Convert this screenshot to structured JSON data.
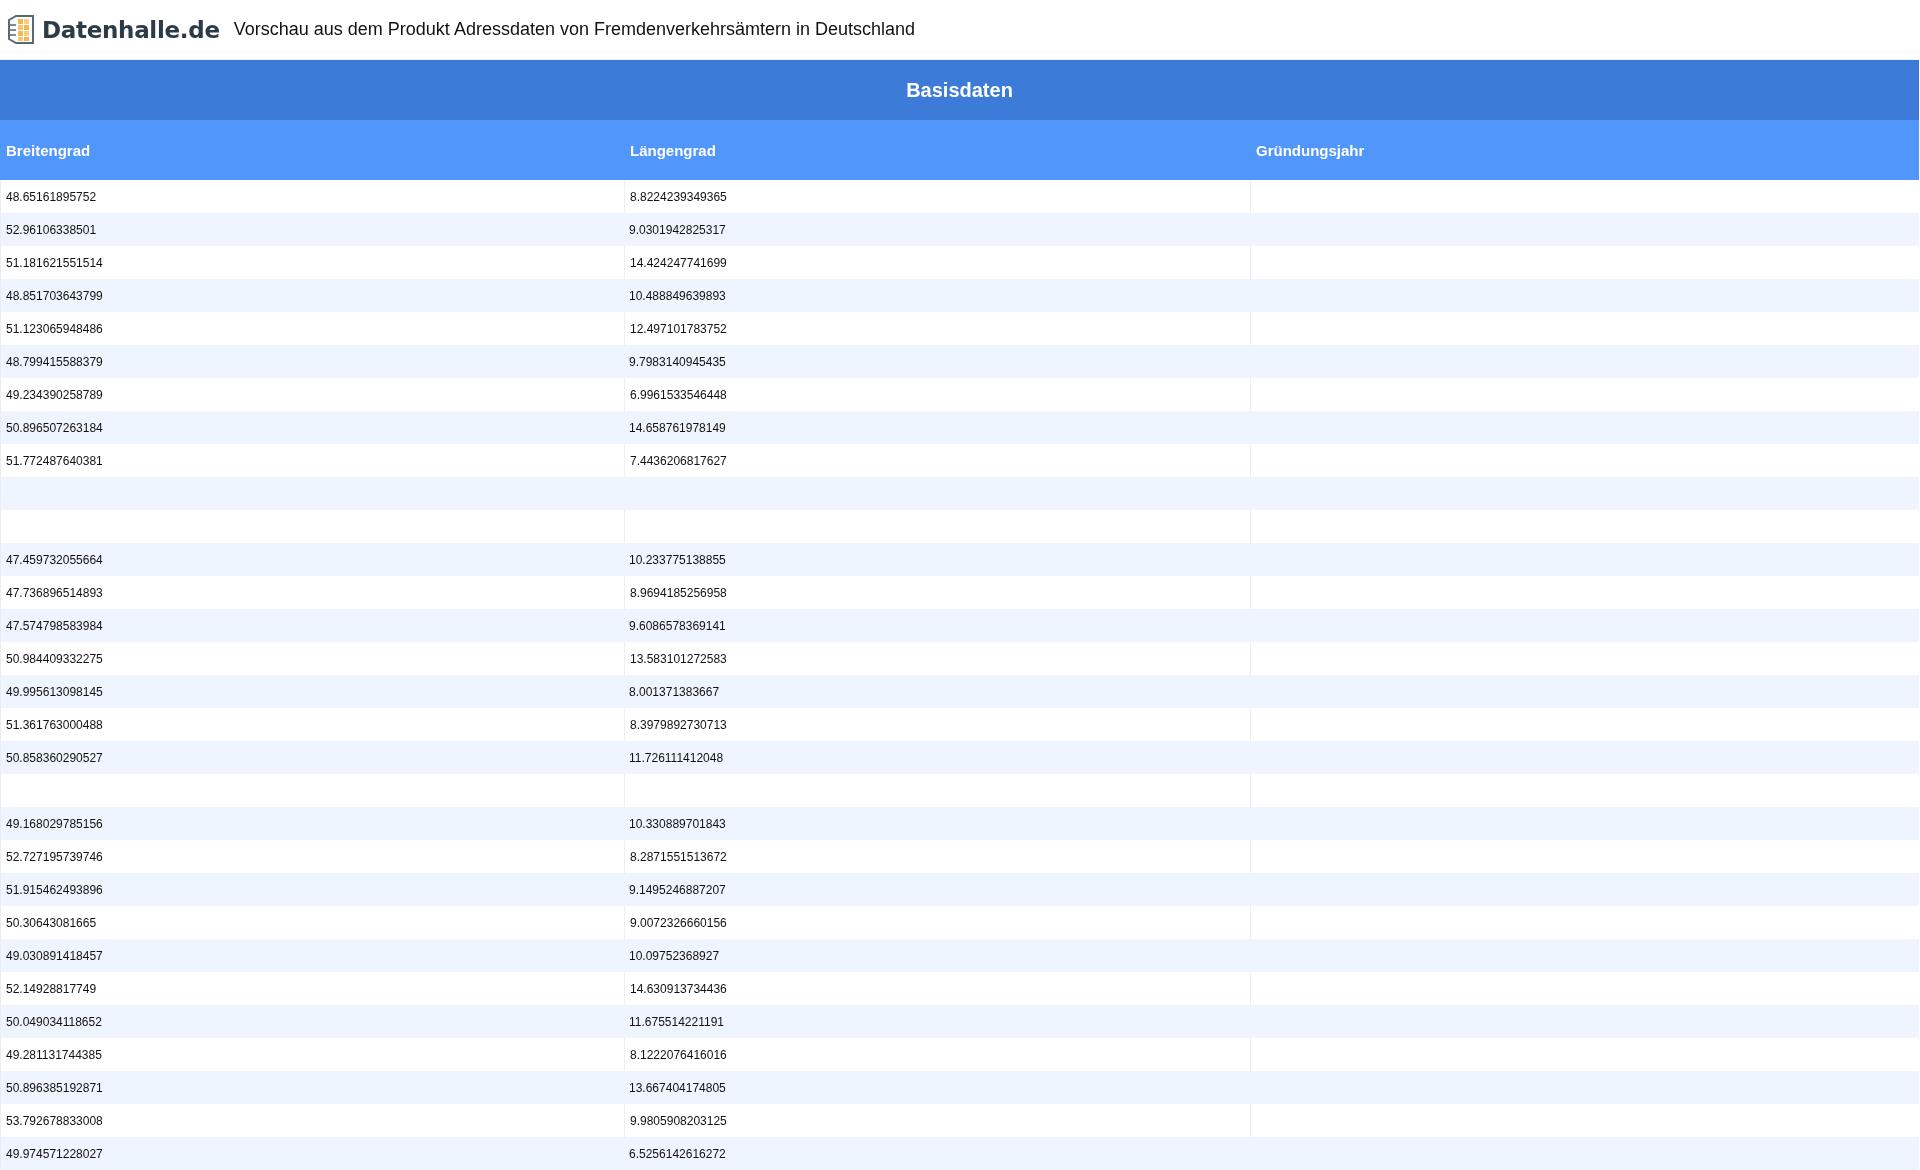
{
  "header": {
    "logo_text": "Datenhalle.de",
    "title": "Vorschau aus dem Produkt Adressdaten von Fremdenverkehrsämtern in Deutschland"
  },
  "table": {
    "title": "Basisdaten",
    "columns": [
      "Breitengrad",
      "Längengrad",
      "Gründungsjahr"
    ],
    "rows": [
      {
        "kind": "data",
        "cells": [
          "48.65161895752",
          "8.8224239349365"
        ]
      },
      {
        "kind": "data",
        "cells": [
          "52.96106338501",
          "9.0301942825317"
        ]
      },
      {
        "kind": "data",
        "cells": [
          "51.181621551514",
          "14.424247741699"
        ]
      },
      {
        "kind": "data",
        "cells": [
          "48.851703643799",
          "10.488849639893"
        ]
      },
      {
        "kind": "data",
        "cells": [
          "51.123065948486",
          "12.497101783752"
        ]
      },
      {
        "kind": "data",
        "cells": [
          "48.799415588379",
          "9.7983140945435"
        ]
      },
      {
        "kind": "data",
        "cells": [
          "49.234390258789",
          "6.9961533546448"
        ]
      },
      {
        "kind": "data",
        "cells": [
          "50.896507263184",
          "14.658761978149"
        ]
      },
      {
        "kind": "data",
        "cells": [
          "51.772487640381",
          "7.4436206817627"
        ]
      },
      {
        "kind": "blank"
      },
      {
        "kind": "blank"
      },
      {
        "kind": "data",
        "cells": [
          "47.459732055664",
          "10.233775138855"
        ]
      },
      {
        "kind": "data",
        "cells": [
          "47.736896514893",
          "8.9694185256958"
        ]
      },
      {
        "kind": "data",
        "cells": [
          "47.574798583984",
          "9.6086578369141"
        ]
      },
      {
        "kind": "data",
        "cells": [
          "50.984409332275",
          "13.583101272583"
        ]
      },
      {
        "kind": "data",
        "cells": [
          "49.995613098145",
          "8.001371383667"
        ]
      },
      {
        "kind": "data",
        "cells": [
          "51.361763000488",
          "8.3979892730713"
        ]
      },
      {
        "kind": "data",
        "cells": [
          "50.858360290527",
          "11.726111412048"
        ]
      },
      {
        "kind": "blank"
      },
      {
        "kind": "data",
        "cells": [
          "49.168029785156",
          "10.330889701843"
        ]
      },
      {
        "kind": "data",
        "cells": [
          "52.727195739746",
          "8.2871551513672"
        ]
      },
      {
        "kind": "data",
        "cells": [
          "51.915462493896",
          "9.1495246887207"
        ]
      },
      {
        "kind": "data",
        "cells": [
          "50.30643081665",
          "9.0072326660156"
        ]
      },
      {
        "kind": "data",
        "cells": [
          "49.030891418457",
          "10.09752368927"
        ]
      },
      {
        "kind": "data",
        "cells": [
          "52.14928817749",
          "14.630913734436"
        ]
      },
      {
        "kind": "data",
        "cells": [
          "50.049034118652",
          "11.675514221191"
        ]
      },
      {
        "kind": "data",
        "cells": [
          "49.281131744385",
          "8.1222076416016"
        ]
      },
      {
        "kind": "data",
        "cells": [
          "50.896385192871",
          "13.667404174805"
        ]
      },
      {
        "kind": "data",
        "cells": [
          "53.792678833008",
          "9.9805908203125"
        ]
      },
      {
        "kind": "data",
        "cells": [
          "49.974571228027",
          "6.5256142616272"
        ]
      }
    ]
  }
}
